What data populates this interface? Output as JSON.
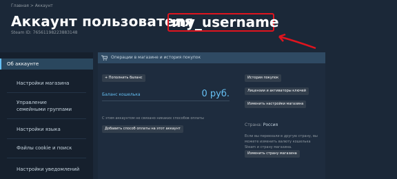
{
  "breadcrumb": "Главная > Аккаунт",
  "page_title": "Аккаунт пользователя",
  "username": "my_username",
  "steam_id": "Steam ID: 76561198223883148",
  "sidebar": {
    "items": [
      {
        "label": "Об аккаунте"
      },
      {
        "label": "Настройки магазина"
      },
      {
        "label": "Управление семейными группами"
      },
      {
        "label": "Настройки языка"
      },
      {
        "label": "Файлы cookie и поиск"
      },
      {
        "label": "Настройки уведомлений"
      }
    ]
  },
  "store_panel": {
    "header": "Операции в магазине и история покупок",
    "add_funds_button": "+ Пополнить баланс",
    "wallet_label": "Баланс кошелька",
    "wallet_value": "0 руб.",
    "no_payment_note": "С этим аккаунтом не связано никаких способов оплаты",
    "add_payment_button": "Добавить способ оплаты на этот аккаунт",
    "purchase_history_button": "История покупок",
    "licenses_button": "Лицензии и активаторы ключей",
    "store_prefs_button": "Изменить настройки магазина",
    "country_label": "Страна:",
    "country_value": "Россия",
    "move_note": "Если вы переехали в другую страну, вы можете изменить валюту кошелька Steam и страну магазина.",
    "change_country_button": "Изменить страну магазина"
  },
  "colors": {
    "background": "#1b2838",
    "annotation_red": "#e0141e",
    "link_blue": "#66c0f4"
  }
}
